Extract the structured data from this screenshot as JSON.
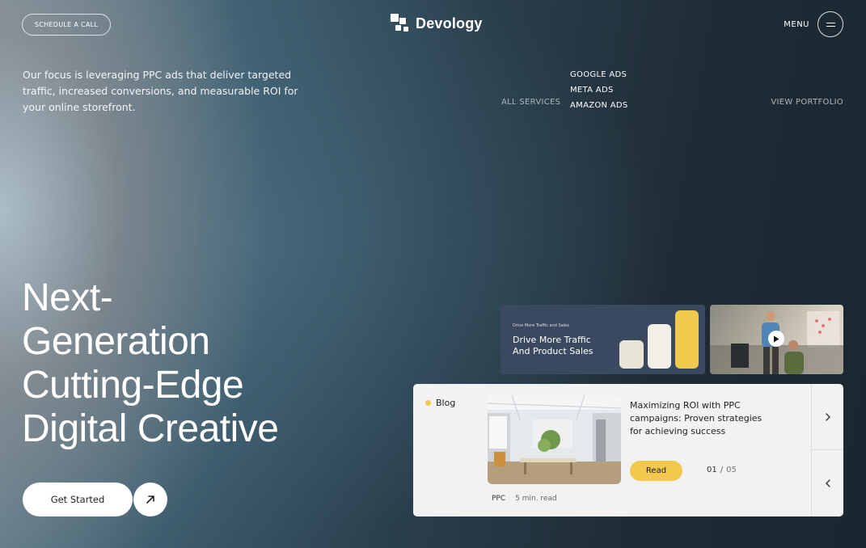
{
  "header": {
    "schedule_label": "SCHEDULE A CALL",
    "brand": "Devology",
    "menu_label": "MENU"
  },
  "intro": {
    "text": "Our focus is leveraging PPC ads that deliver targeted traffic, increased conversions, and measurable ROI for your online storefront."
  },
  "services": {
    "label": "ALL SERVICES",
    "items": [
      "GOOGLE ADS",
      "META ADS",
      "AMAZON ADS"
    ]
  },
  "portfolio_label": "VIEW PORTFOLIO",
  "hero": {
    "line1": "Next-",
    "line2": "Generation",
    "line3": "Cutting-Edge",
    "line4": "Digital Creative",
    "cta_label": "Get Started"
  },
  "promo": {
    "small_text": "Drive More Traffic and Sales",
    "title": "Drive More Traffic And Product Sales"
  },
  "blog": {
    "tag": "Blog",
    "title": "Maximizing ROI with PPC campaigns: Proven strategies for achieving success",
    "read_label": "Read",
    "page_current": "01",
    "page_sep": "/",
    "page_total": "05",
    "category": "PPC",
    "read_time": "5 min. read"
  },
  "colors": {
    "accent_yellow": "#f2c94c",
    "promo_bg": "#3a4960"
  }
}
